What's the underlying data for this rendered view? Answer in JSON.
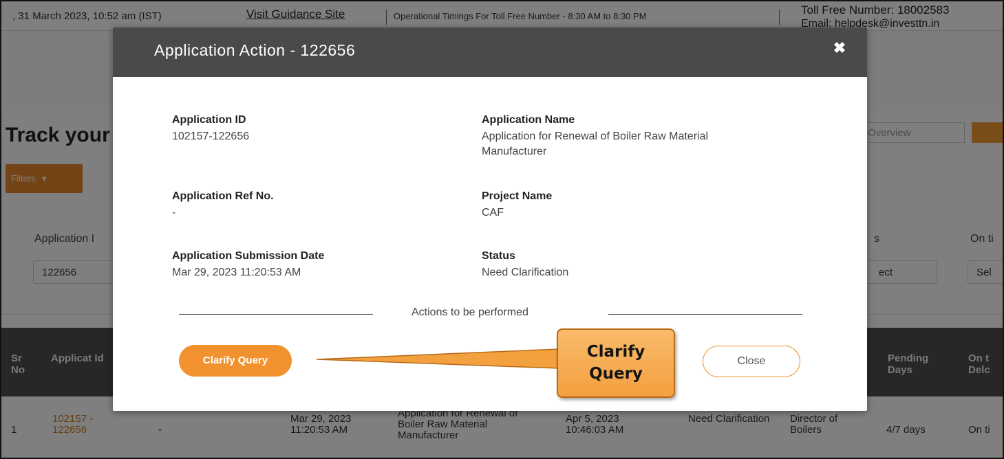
{
  "topbar": {
    "date_text": ", 31 March 2023, 10:52 am (IST)",
    "guidance_link": "Visit Guidance Site",
    "timings": "Operational Timings For Toll Free Number - 8:30 AM to 8:30 PM",
    "toll_free": "Toll Free Number: 18002583",
    "email": "Email: helpdesk@investtn.in"
  },
  "page": {
    "title": "Track your",
    "overview_label": "Overview",
    "filters_label": "Filters"
  },
  "search": {
    "application_label": "Application I",
    "application_value": "122656",
    "status_label": "s",
    "status_value": "ect",
    "ontime_label": "On ti",
    "ontime_value": "Sel"
  },
  "table": {
    "headers": {
      "sr": "Sr No",
      "app_id": "Applicat Id",
      "pending": "Pending Days",
      "ontime": "On t Delc"
    },
    "row": {
      "sr": "1",
      "app_id": "102157 - 122656",
      "ref": "-",
      "submitted": "Mar 29, 2023 11:20:53 AM",
      "name": "Application for Renewal of Boiler Raw Material Manufacturer",
      "updated": "Apr 5, 2023 10:46:03 AM",
      "status": "Need Clarification",
      "department": "Director of Boilers",
      "pending": "4/7 days",
      "ontime": "On ti"
    }
  },
  "modal": {
    "title": "Application Action - 122656",
    "close_icon": "close-icon",
    "fields": {
      "app_id_label": "Application ID",
      "app_id_value": "102157-122656",
      "app_name_label": "Application Name",
      "app_name_line1": "Application for Renewal of Boiler Raw Material",
      "app_name_line2": "Manufacturer",
      "ref_label": "Application Ref No.",
      "ref_value": "-",
      "project_label": "Project Name",
      "project_value": "CAF",
      "date_label": "Application Submission Date",
      "date_value": "Mar 29, 2023 11:20:53 AM",
      "status_label": "Status",
      "status_value": "Need Clarification"
    },
    "actions_caption": "Actions to be performed",
    "clarify_button": "Clarify Query",
    "close_button": "Close"
  },
  "callout": {
    "line1": "Clarify",
    "line2": "Query"
  },
  "colors": {
    "accent_orange": "#f1922f",
    "modal_header": "#4a4a4a",
    "table_header": "#4f4f4f"
  }
}
